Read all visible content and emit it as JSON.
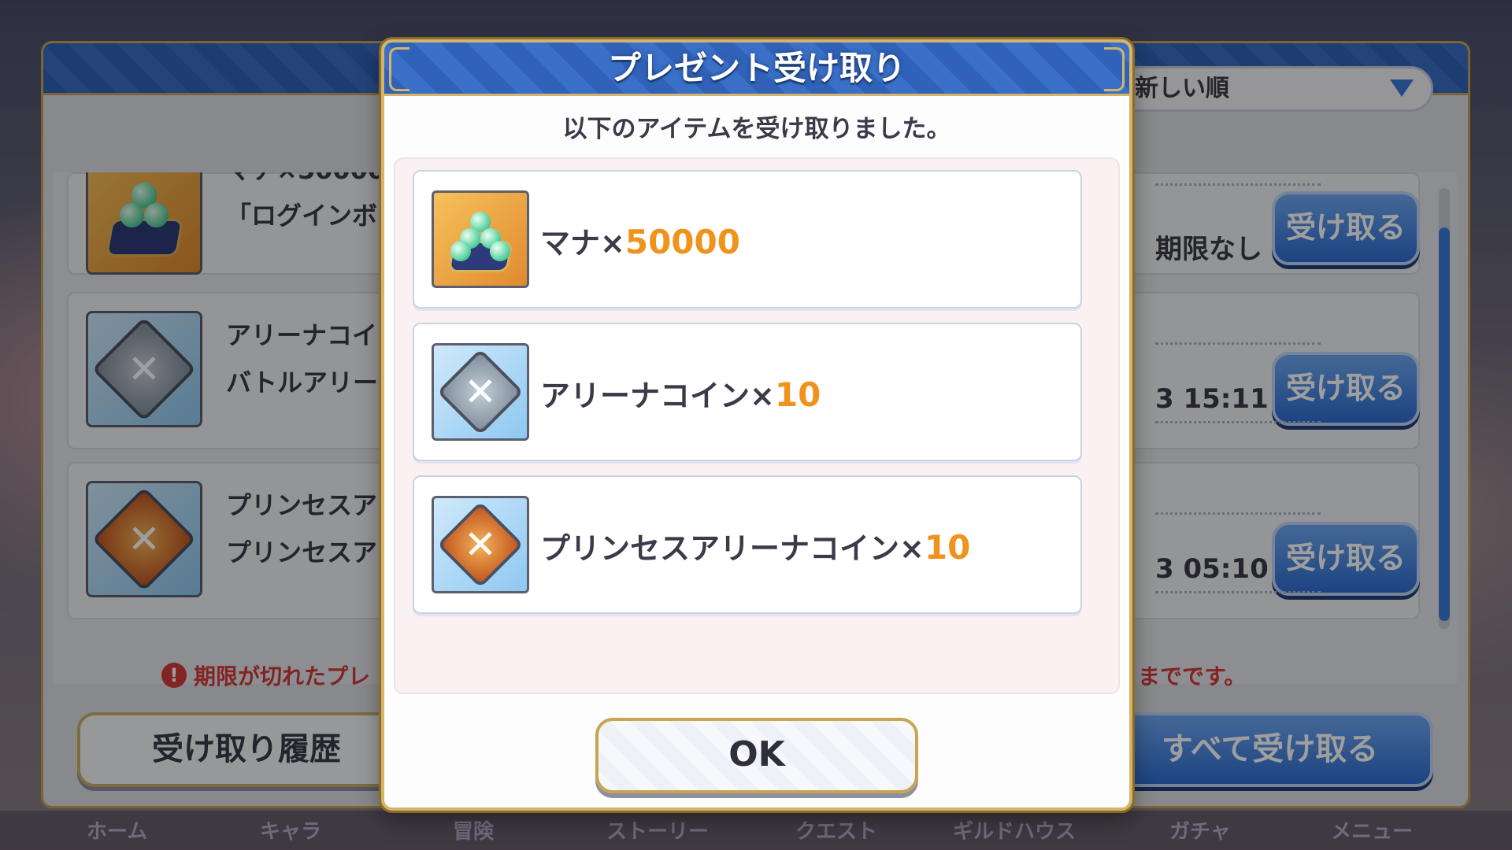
{
  "background": {
    "sort": {
      "label": "新しい順"
    },
    "rows": [
      {
        "title": "マナ×50000",
        "desc": "「ログインボ",
        "date": "期限なし",
        "button": "受け取る"
      },
      {
        "title": "アリーナコイ",
        "desc": "バトルアリー",
        "date": "3 15:11",
        "button": "受け取る"
      },
      {
        "title": "プリンセスア",
        "desc": "プリンセスア",
        "date": "3 05:10",
        "button": "受け取る"
      }
    ],
    "notice_left": "期限が切れたプレ",
    "notice_right": "までです。",
    "history_button": "受け取り履歴",
    "receive_all_button": "すべて受け取る",
    "nav": [
      "ホーム",
      "キャラ",
      "冒険",
      "ストーリー",
      "クエスト",
      "ギルドハウス",
      "ガチャ",
      "メニュー"
    ]
  },
  "modal": {
    "title": "プレゼント受け取り",
    "subtitle": "以下のアイテムを受け取りました。",
    "items": [
      {
        "name": "マナ×",
        "qty": "50000",
        "icon": "mana-icon"
      },
      {
        "name": "アリーナコイン×",
        "qty": "10",
        "icon": "arena-coin-icon"
      },
      {
        "name": "プリンセスアリーナコイン×",
        "qty": "10",
        "icon": "princess-arena-coin-icon"
      }
    ],
    "ok_label": "OK"
  },
  "colors": {
    "accent_blue": "#2f62b8",
    "gold_border": "#d3b46a",
    "qty_orange": "#f0931c",
    "notice_red": "#d43a3a"
  }
}
